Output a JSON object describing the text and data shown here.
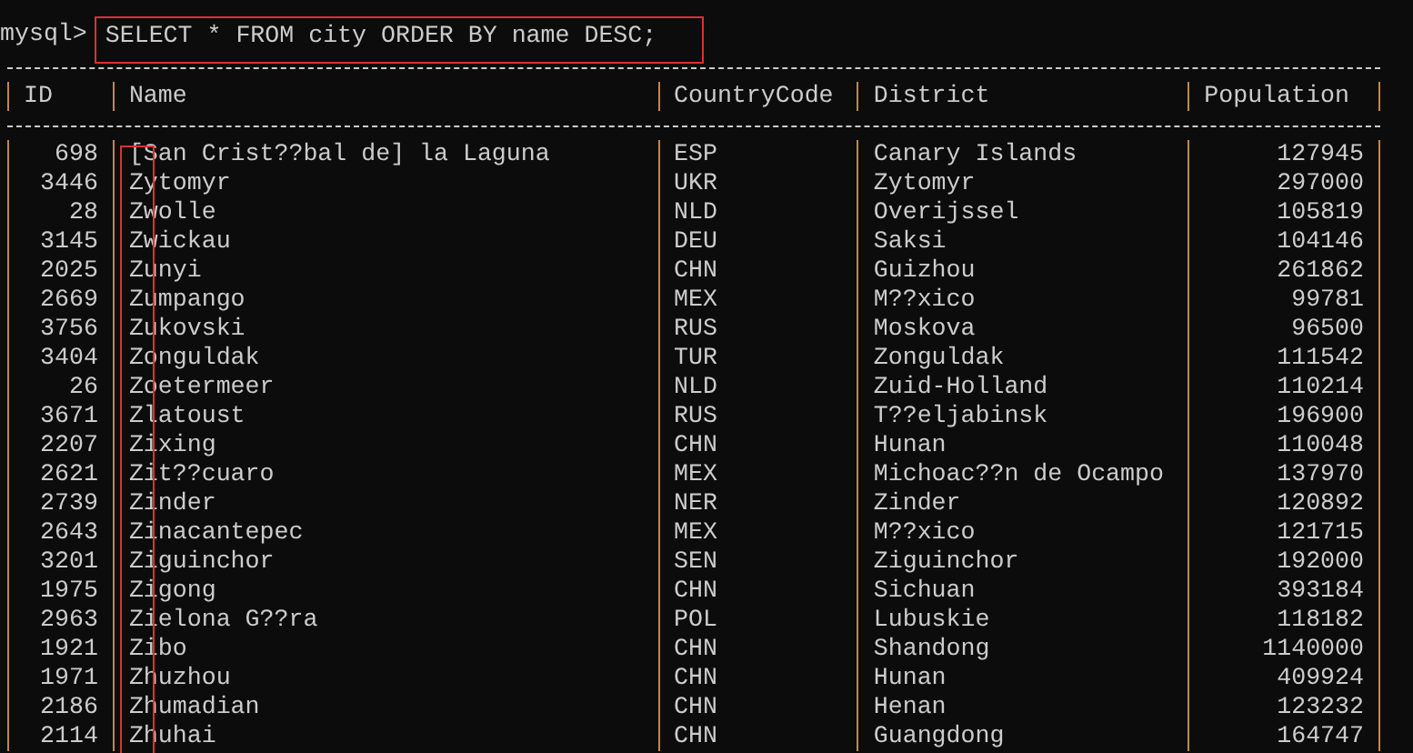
{
  "prompt": "mysql>",
  "query": "SELECT * FROM city ORDER BY name DESC;",
  "columns": [
    {
      "label": "ID",
      "numeric": true
    },
    {
      "label": "Name",
      "numeric": false
    },
    {
      "label": "CountryCode",
      "numeric": false
    },
    {
      "label": "District",
      "numeric": false
    },
    {
      "label": "Population",
      "numeric": true
    }
  ],
  "rows": [
    [
      "698",
      "[San Crist??bal de] la Laguna",
      "ESP",
      "Canary Islands",
      "127945"
    ],
    [
      "3446",
      "Zytomyr",
      "UKR",
      "Zytomyr",
      "297000"
    ],
    [
      "28",
      "Zwolle",
      "NLD",
      "Overijssel",
      "105819"
    ],
    [
      "3145",
      "Zwickau",
      "DEU",
      "Saksi",
      "104146"
    ],
    [
      "2025",
      "Zunyi",
      "CHN",
      "Guizhou",
      "261862"
    ],
    [
      "2669",
      "Zumpango",
      "MEX",
      "M??xico",
      "99781"
    ],
    [
      "3756",
      "Zukovski",
      "RUS",
      "Moskova",
      "96500"
    ],
    [
      "3404",
      "Zonguldak",
      "TUR",
      "Zonguldak",
      "111542"
    ],
    [
      "26",
      "Zoetermeer",
      "NLD",
      "Zuid-Holland",
      "110214"
    ],
    [
      "3671",
      "Zlatoust",
      "RUS",
      "T??eljabinsk",
      "196900"
    ],
    [
      "2207",
      "Zixing",
      "CHN",
      "Hunan",
      "110048"
    ],
    [
      "2621",
      "Zit??cuaro",
      "MEX",
      "Michoac??n de Ocampo",
      "137970"
    ],
    [
      "2739",
      "Zinder",
      "NER",
      "Zinder",
      "120892"
    ],
    [
      "2643",
      "Zinacantepec",
      "MEX",
      "M??xico",
      "121715"
    ],
    [
      "3201",
      "Ziguinchor",
      "SEN",
      "Ziguinchor",
      "192000"
    ],
    [
      "1975",
      "Zigong",
      "CHN",
      "Sichuan",
      "393184"
    ],
    [
      "2963",
      "Zielona G??ra",
      "POL",
      "Lubuskie",
      "118182"
    ],
    [
      "1921",
      "Zibo",
      "CHN",
      "Shandong",
      "1140000"
    ],
    [
      "1971",
      "Zhuzhou",
      "CHN",
      "Hunan",
      "409924"
    ],
    [
      "2186",
      "Zhumadian",
      "CHN",
      "Henan",
      "123232"
    ],
    [
      "2114",
      "Zhuhai",
      "CHN",
      "Guangdong",
      "164747"
    ]
  ]
}
